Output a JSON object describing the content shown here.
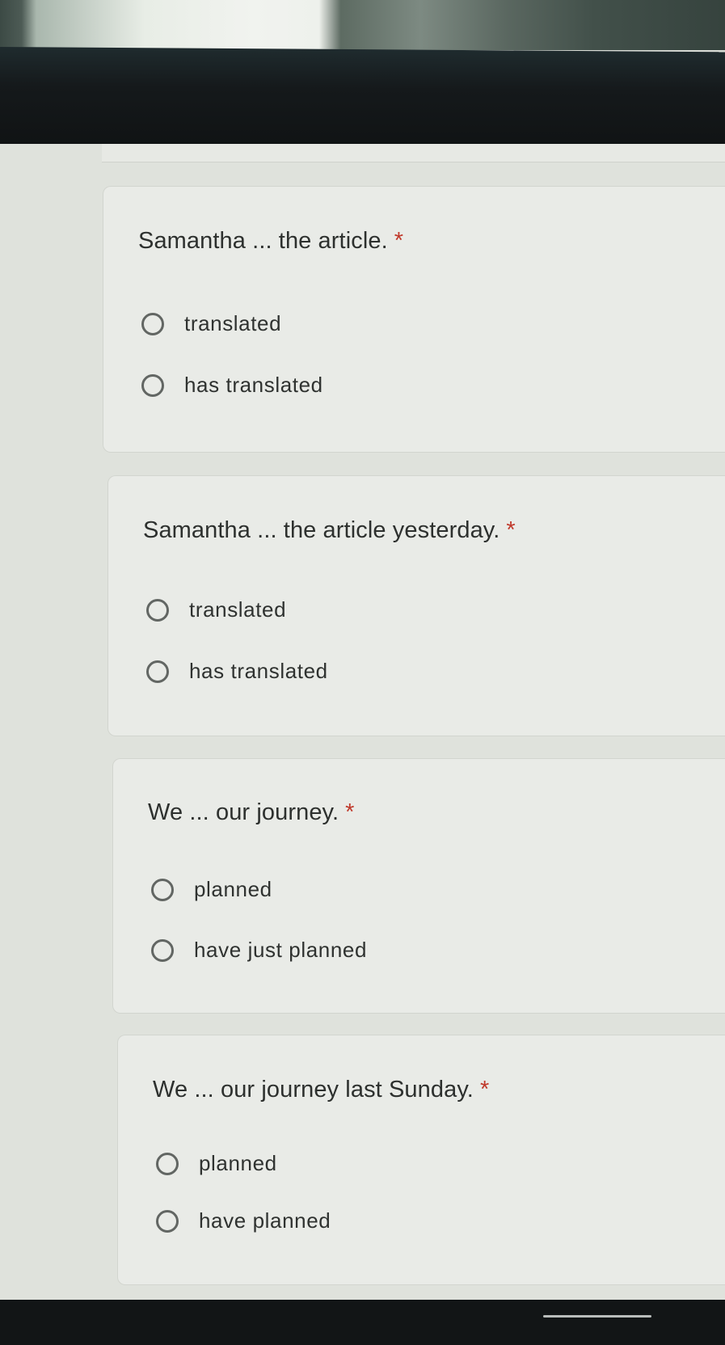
{
  "questions": [
    {
      "text": "Samantha ... the article.",
      "required_mark": "*",
      "options": [
        "translated",
        "has translated"
      ]
    },
    {
      "text": "Samantha ... the article yesterday.",
      "required_mark": "*",
      "options": [
        "translated",
        "has translated"
      ]
    },
    {
      "text": "We ... our journey.",
      "required_mark": "*",
      "options": [
        "planned",
        "have just planned"
      ]
    },
    {
      "text": "We ... our journey last Sunday.",
      "required_mark": "*",
      "options": [
        "planned",
        "have planned"
      ]
    }
  ],
  "colors": {
    "required": "#c0392b",
    "card_background": "#e9ebe7",
    "page_background": "#dfe2dc"
  }
}
